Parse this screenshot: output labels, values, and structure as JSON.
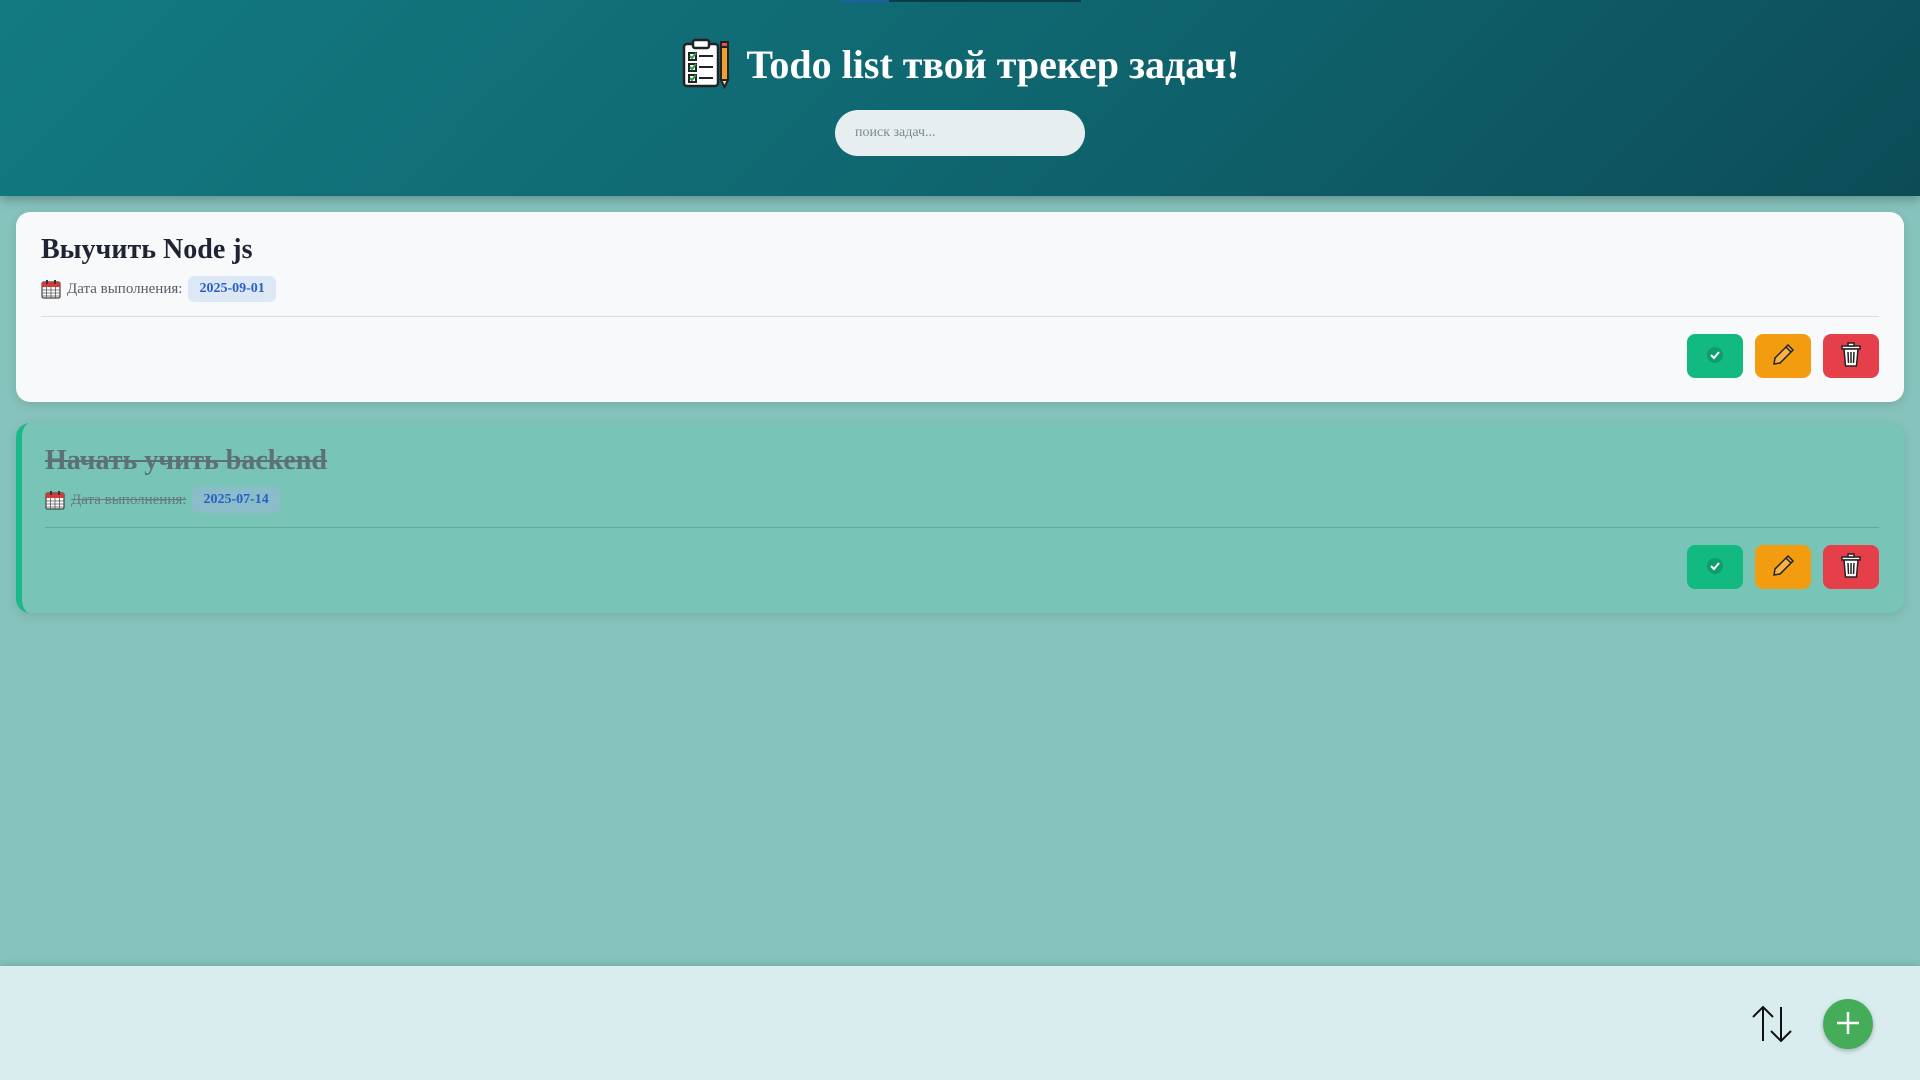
{
  "header": {
    "title": "Todo list твой трекер задач!",
    "title_icon": "clipboard-checklist-icon",
    "search_placeholder": "поиск задач..."
  },
  "tasks": [
    {
      "title": "Выучить Node js",
      "date_label": "Дата выполнения:",
      "date": "2025-09-01",
      "completed": false
    },
    {
      "title": "Начать учить backend",
      "date_label": "Дата выполнения:",
      "date": "2025-07-14",
      "completed": true
    }
  ],
  "icons": {
    "calendar": "calendar-icon",
    "complete": "check-icon",
    "edit": "pencil-icon",
    "delete": "trash-icon",
    "sort": "sort-arrows-icon",
    "add": "plus-icon"
  },
  "colors": {
    "header_bg": "#0f6770",
    "page_bg": "#86c3bc",
    "complete_btn": "#12b981",
    "edit_btn": "#f39c0f",
    "delete_btn": "#e5404a",
    "add_btn": "#45ad5a",
    "done_card_bg": "#78c4b7"
  }
}
